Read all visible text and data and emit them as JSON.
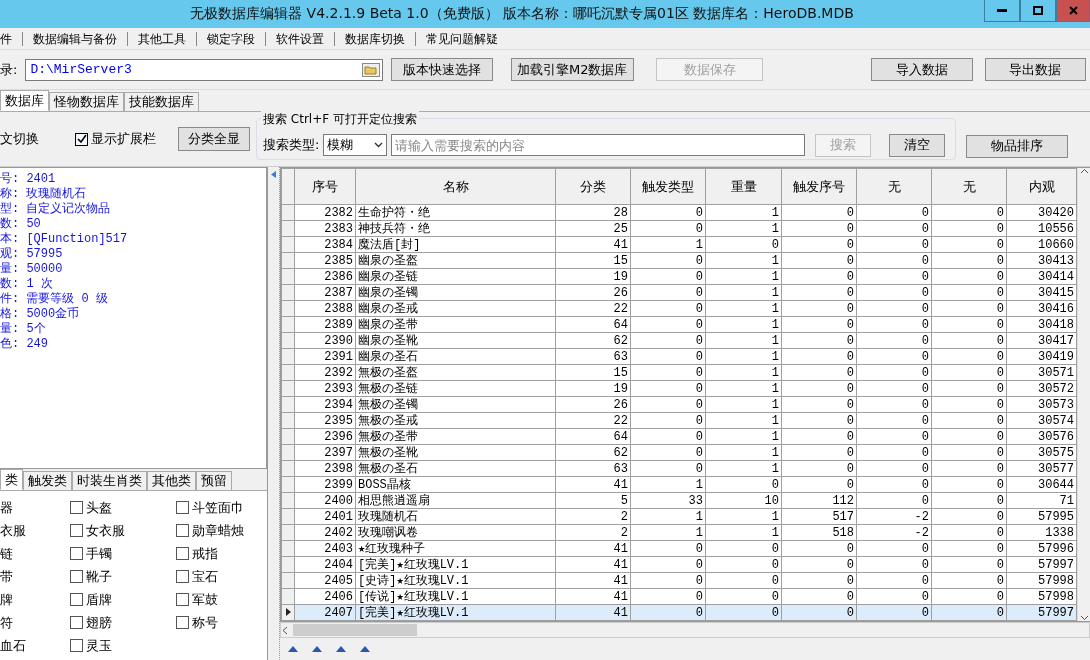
{
  "window": {
    "title": "无极数据库编辑器 V4.2.1.9   Beta 1.0（免费版）   版本名称：哪吒沉默专属01区    数据库名：HeroDB.MDB"
  },
  "menu": [
    "件",
    "数据编辑与备份",
    "其他工具",
    "锁定字段",
    "软件设置",
    "数据库切换",
    "常见问题解疑"
  ],
  "toolbar": {
    "path_label": "录:",
    "path_value": "D:\\MirServer3",
    "buttons": [
      {
        "label": "版本快速选择",
        "disabled": false
      },
      {
        "label": "加载引擎M2数据库",
        "disabled": false
      },
      {
        "label": "数据保存",
        "disabled": true
      },
      {
        "label": "导入数据",
        "disabled": false
      },
      {
        "label": "导出数据",
        "disabled": false
      }
    ]
  },
  "tabs": [
    {
      "label": "数据库",
      "selected": true
    },
    {
      "label": "怪物数据库",
      "selected": false
    },
    {
      "label": "技能数据库",
      "selected": false
    }
  ],
  "options": {
    "language_toggle": "文切换",
    "show_extension": {
      "label": "显示扩展栏",
      "checked": true
    },
    "show_all_button": "分类全显"
  },
  "search": {
    "title": "搜索   Ctrl+F 可打开定位搜索",
    "type_label": "搜索类型:",
    "type_value": "模糊",
    "placeholder": "请输入需要搜索的内容",
    "buttons": [
      {
        "label": "搜索",
        "disabled": true
      },
      {
        "label": "清空",
        "disabled": false
      }
    ],
    "sort_button": "物品排序"
  },
  "details": [
    "号: 2401",
    "称: 玫瑰随机石",
    "型: 自定义记次物品",
    "数: 50",
    "本: [QFunction]517",
    "观: 57995",
    "量: 50000",
    "数: 1 次",
    "件: 需要等级 0 级",
    "格: 5000金币",
    "量: 5个",
    "色: 249"
  ],
  "category_tabs": [
    {
      "label": "类",
      "selected": true
    },
    {
      "label": "触发类",
      "selected": false
    },
    {
      "label": "时装生肖类",
      "selected": false
    },
    {
      "label": "其他类",
      "selected": false
    },
    {
      "label": "预留",
      "selected": false
    }
  ],
  "categories": [
    {
      "label": "器",
      "kind": "plain"
    },
    {
      "label": "头盔",
      "kind": "checkbox",
      "checked": false
    },
    {
      "label": "斗笠面巾",
      "kind": "checkbox",
      "checked": false
    },
    {
      "label": "衣服",
      "kind": "plain"
    },
    {
      "label": "女衣服",
      "kind": "checkbox",
      "checked": false
    },
    {
      "label": "勋章蜡烛",
      "kind": "checkbox",
      "checked": false
    },
    {
      "label": "链",
      "kind": "plain"
    },
    {
      "label": "手镯",
      "kind": "checkbox",
      "checked": false
    },
    {
      "label": "戒指",
      "kind": "checkbox",
      "checked": false
    },
    {
      "label": "带",
      "kind": "plain"
    },
    {
      "label": "靴子",
      "kind": "checkbox",
      "checked": false
    },
    {
      "label": "宝石",
      "kind": "checkbox",
      "checked": false
    },
    {
      "label": "牌",
      "kind": "plain"
    },
    {
      "label": "盾牌",
      "kind": "checkbox",
      "checked": false
    },
    {
      "label": "军鼓",
      "kind": "checkbox",
      "checked": false
    },
    {
      "label": "符",
      "kind": "plain"
    },
    {
      "label": "翅膀",
      "kind": "checkbox",
      "checked": false
    },
    {
      "label": "称号",
      "kind": "checkbox",
      "checked": false
    },
    {
      "label": "血石",
      "kind": "plain"
    },
    {
      "label": "灵玉",
      "kind": "checkbox",
      "checked": false
    }
  ],
  "table": {
    "columns": [
      "序号",
      "名称",
      "分类",
      "触发类型",
      "重量",
      "触发序号",
      "无",
      "无",
      "内观"
    ],
    "rows": [
      {
        "cells": [
          "2382",
          "生命护符・绝",
          "28",
          "0",
          "1",
          "0",
          "0",
          "0",
          "30420"
        ],
        "selected": false
      },
      {
        "cells": [
          "2383",
          "神技兵符・绝",
          "25",
          "0",
          "1",
          "0",
          "0",
          "0",
          "10556"
        ],
        "selected": false
      },
      {
        "cells": [
          "2384",
          "魔法盾[封]",
          "41",
          "1",
          "0",
          "0",
          "0",
          "0",
          "10660"
        ],
        "selected": false
      },
      {
        "cells": [
          "2385",
          "幽泉の圣盔",
          "15",
          "0",
          "1",
          "0",
          "0",
          "0",
          "30413"
        ],
        "selected": false
      },
      {
        "cells": [
          "2386",
          "幽泉の圣链",
          "19",
          "0",
          "1",
          "0",
          "0",
          "0",
          "30414"
        ],
        "selected": false
      },
      {
        "cells": [
          "2387",
          "幽泉の圣镯",
          "26",
          "0",
          "1",
          "0",
          "0",
          "0",
          "30415"
        ],
        "selected": false
      },
      {
        "cells": [
          "2388",
          "幽泉の圣戒",
          "22",
          "0",
          "1",
          "0",
          "0",
          "0",
          "30416"
        ],
        "selected": false
      },
      {
        "cells": [
          "2389",
          "幽泉の圣带",
          "64",
          "0",
          "1",
          "0",
          "0",
          "0",
          "30418"
        ],
        "selected": false
      },
      {
        "cells": [
          "2390",
          "幽泉の圣靴",
          "62",
          "0",
          "1",
          "0",
          "0",
          "0",
          "30417"
        ],
        "selected": false
      },
      {
        "cells": [
          "2391",
          "幽泉の圣石",
          "63",
          "0",
          "1",
          "0",
          "0",
          "0",
          "30419"
        ],
        "selected": false
      },
      {
        "cells": [
          "2392",
          "無极の圣盔",
          "15",
          "0",
          "1",
          "0",
          "0",
          "0",
          "30571"
        ],
        "selected": false
      },
      {
        "cells": [
          "2393",
          "無极の圣链",
          "19",
          "0",
          "1",
          "0",
          "0",
          "0",
          "30572"
        ],
        "selected": false
      },
      {
        "cells": [
          "2394",
          "無极の圣镯",
          "26",
          "0",
          "1",
          "0",
          "0",
          "0",
          "30573"
        ],
        "selected": false
      },
      {
        "cells": [
          "2395",
          "無极の圣戒",
          "22",
          "0",
          "1",
          "0",
          "0",
          "0",
          "30574"
        ],
        "selected": false
      },
      {
        "cells": [
          "2396",
          "無极の圣带",
          "64",
          "0",
          "1",
          "0",
          "0",
          "0",
          "30576"
        ],
        "selected": false
      },
      {
        "cells": [
          "2397",
          "無极の圣靴",
          "62",
          "0",
          "1",
          "0",
          "0",
          "0",
          "30575"
        ],
        "selected": false
      },
      {
        "cells": [
          "2398",
          "無极の圣石",
          "63",
          "0",
          "1",
          "0",
          "0",
          "0",
          "30577"
        ],
        "selected": false
      },
      {
        "cells": [
          "2399",
          "BOSS晶核",
          "41",
          "1",
          "0",
          "0",
          "0",
          "0",
          "30644"
        ],
        "selected": false
      },
      {
        "cells": [
          "2400",
          "相思熊逍遥扇",
          "5",
          "33",
          "10",
          "112",
          "0",
          "0",
          "71"
        ],
        "selected": false
      },
      {
        "cells": [
          "2401",
          "玫瑰随机石",
          "2",
          "1",
          "1",
          "517",
          "-2",
          "0",
          "57995"
        ],
        "selected": false
      },
      {
        "cells": [
          "2402",
          "玫瑰嘲讽卷",
          "2",
          "1",
          "1",
          "518",
          "-2",
          "0",
          "1338"
        ],
        "selected": false
      },
      {
        "cells": [
          "2403",
          "★红玫瑰种子",
          "41",
          "0",
          "0",
          "0",
          "0",
          "0",
          "57996"
        ],
        "selected": false
      },
      {
        "cells": [
          "2404",
          "[完美]★红玫瑰LV.1",
          "41",
          "0",
          "0",
          "0",
          "0",
          "0",
          "57997"
        ],
        "selected": false
      },
      {
        "cells": [
          "2405",
          "[史诗]★红玫瑰LV.1",
          "41",
          "0",
          "0",
          "0",
          "0",
          "0",
          "57998"
        ],
        "selected": false
      },
      {
        "cells": [
          "2406",
          "[传说]★红玫瑰LV.1",
          "41",
          "0",
          "0",
          "0",
          "0",
          "0",
          "57998"
        ],
        "selected": false
      },
      {
        "cells": [
          "2407",
          "[完美]★红玫瑰LV.1",
          "41",
          "0",
          "0",
          "0",
          "0",
          "0",
          "57997"
        ],
        "selected": true
      }
    ]
  }
}
